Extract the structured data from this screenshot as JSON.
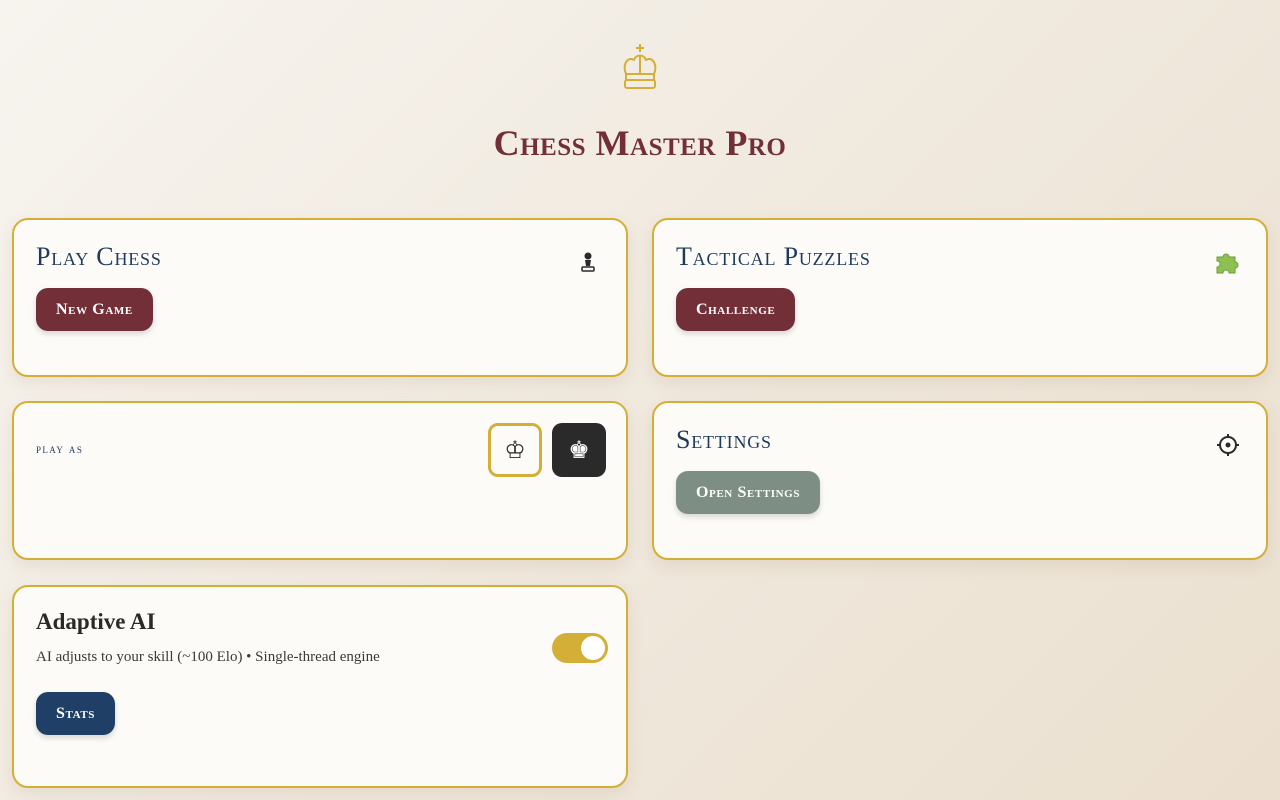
{
  "app": {
    "title": "Chess Master Pro",
    "logo_icon": "crown-icon"
  },
  "colors": {
    "gold": "#d4af37",
    "wine": "#722f37",
    "navy": "#1f3f66",
    "sage": "#7d8f84",
    "dark": "#2a2a2a"
  },
  "play_chess": {
    "title": "Play Chess",
    "icon": "pawn-icon",
    "button_label": "New Game"
  },
  "puzzles": {
    "title": "Tactical Puzzles",
    "icon": "puzzle-piece-icon",
    "button_label": "Challenge"
  },
  "play_as": {
    "label": "play as",
    "options": [
      {
        "name": "white",
        "glyph": "♔",
        "selected": true
      },
      {
        "name": "black",
        "glyph": "♚",
        "selected": false
      }
    ]
  },
  "settings": {
    "title": "Settings",
    "icon": "gear-icon",
    "button_label": "Open Settings"
  },
  "adaptive_ai": {
    "title": "Adaptive AI",
    "description": "AI adjusts to your skill (~100 Elo) • Single-thread engine",
    "enabled": true,
    "button_label": "Stats"
  }
}
